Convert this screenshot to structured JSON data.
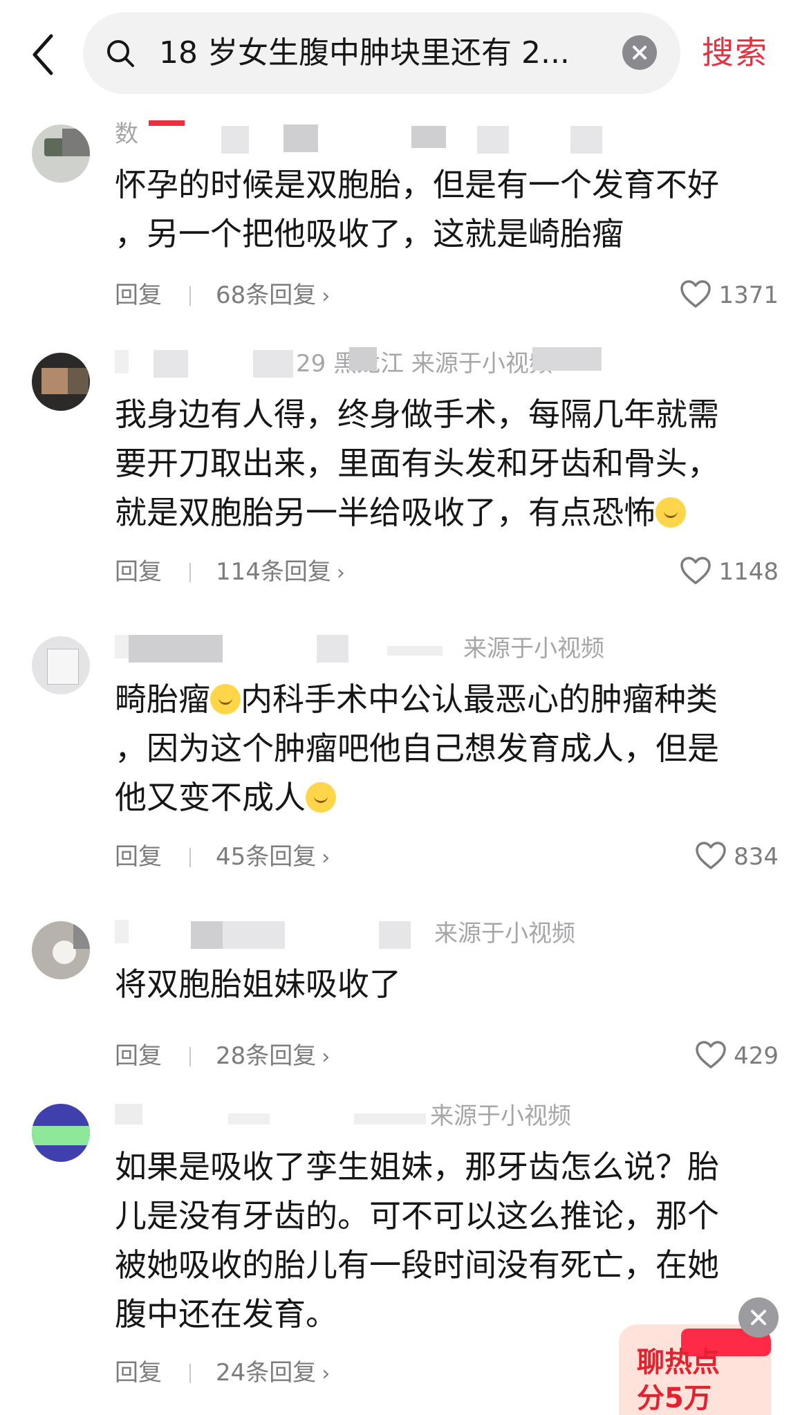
{
  "header": {
    "search_query": "18 岁女生腹中肿块里还有 2...",
    "search_button": "搜索"
  },
  "comments": [
    {
      "meta": "数",
      "lines": [
        "怀孕的时候是双胞胎，但是有一个发育不好",
        "，另一个把他吸收了，这就是崎胎瘤"
      ],
      "reply_label": "回复",
      "reply_count": "68条回复",
      "likes": "1371"
    },
    {
      "meta": "29  黑龙江  来源于小视频",
      "lines": [
        "我身边有人得，终身做手术，每隔几年就需",
        "要开刀取出来，里面有头发和牙齿和骨头，",
        "就是双胞胎另一半给吸收了，有点恐怖"
      ],
      "reply_label": "回复",
      "reply_count": "114条回复",
      "likes": "1148"
    },
    {
      "meta": "来源于小视频",
      "lines": [
        "畸胎瘤",
        "内科手术中公认最恶心的肿瘤种类",
        "，因为这个肿瘤吧他自己想发育成人，但是",
        "他又变不成人"
      ],
      "reply_label": "回复",
      "reply_count": "45条回复",
      "likes": "834"
    },
    {
      "meta": "来源于小视频",
      "lines": [
        "将双胞胎姐妹吸收了"
      ],
      "reply_label": "回复",
      "reply_count": "28条回复",
      "likes": "429"
    },
    {
      "meta": "来源于小视频",
      "lines": [
        "如果是吸收了孪生姐妹，那牙齿怎么说？胎",
        "儿是没有牙齿的。可不可以这么推论，那个",
        "被她吸收的胎儿有一段时间没有死亡，在她",
        "腹中还在发育。"
      ],
      "reply_label": "回复",
      "reply_count": "24条回复",
      "likes": ""
    }
  ],
  "floating_badge": {
    "line1": "聊热点",
    "line2": "分5万"
  },
  "colors": {
    "accent": "#e8303f",
    "text": "#161616",
    "muted": "#7c7c80",
    "search_bg": "#f2f2f3"
  },
  "icons": {
    "back": "chevron-left",
    "search": "magnifier",
    "clear": "circle-x",
    "like": "heart-outline",
    "emoji_laugh_cry": "laughing-crying-face",
    "emoji_pleading": "pleading-face"
  }
}
